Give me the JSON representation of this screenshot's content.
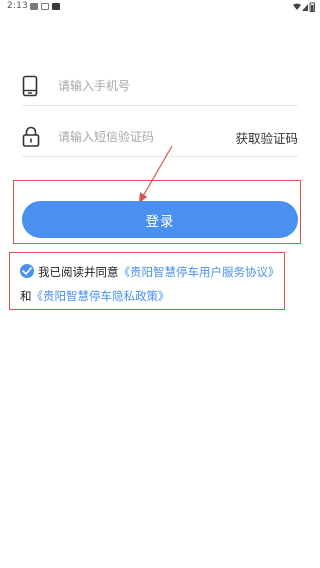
{
  "status_bar": {
    "time": "2:13"
  },
  "form": {
    "phone_placeholder": "请输入手机号",
    "code_placeholder": "请输入短信验证码",
    "get_code_label": "获取验证码"
  },
  "login": {
    "button_label": "登录"
  },
  "agreement": {
    "prefix": "我已阅读并同意",
    "user_agreement_link": "《贵阳智慧停车用户服务协议》",
    "connector": "和",
    "privacy_policy_link": "《贵阳智慧停车隐私政策》"
  },
  "annotation": {
    "highlight_color": "#d9534f"
  },
  "colors": {
    "accent": "#4a90ee",
    "placeholder": "#a8a8a8",
    "text": "#333333"
  },
  "icons": {
    "phone": "phone-icon",
    "lock": "lock-icon",
    "check": "check-circle-icon"
  }
}
